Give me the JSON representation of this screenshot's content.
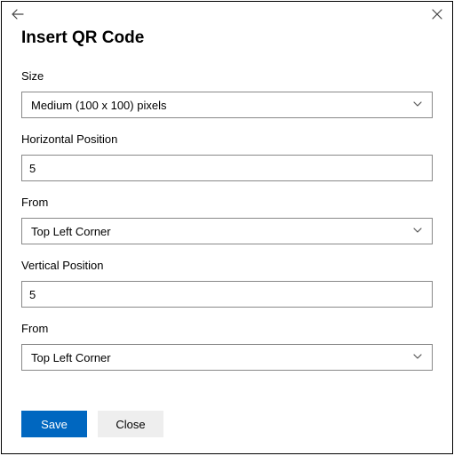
{
  "title": "Insert QR Code",
  "fields": {
    "size": {
      "label": "Size",
      "value": "Medium (100 x 100) pixels"
    },
    "hpos": {
      "label": "Horizontal Position",
      "value": "5"
    },
    "from1": {
      "label": "From",
      "value": "Top Left Corner"
    },
    "vpos": {
      "label": "Vertical Position",
      "value": "5"
    },
    "from2": {
      "label": "From",
      "value": "Top Left Corner"
    }
  },
  "buttons": {
    "save": "Save",
    "close": "Close"
  }
}
